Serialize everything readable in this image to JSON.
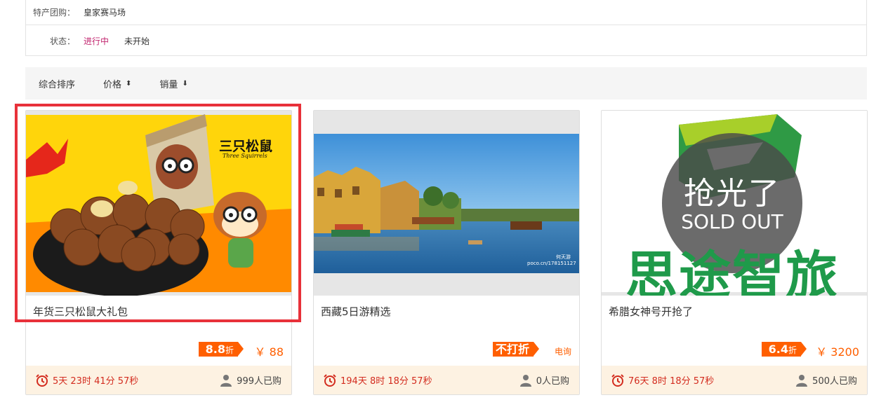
{
  "filters": {
    "tuangou": {
      "label": "特产团购：",
      "options": [
        "皇家赛马场"
      ]
    },
    "status": {
      "label": "状态：",
      "options": [
        "进行中",
        "未开始"
      ],
      "active": 0
    }
  },
  "sort": {
    "items": [
      {
        "label": "综合排序",
        "icon": ""
      },
      {
        "label": "价格",
        "icon": "⬍"
      },
      {
        "label": "销量",
        "icon": "⬇"
      }
    ]
  },
  "cards": [
    {
      "title": "年货三只松鼠大礼包",
      "discount": "8.8",
      "discount_unit": "折",
      "price": "￥ 88",
      "countdown": "5天 23时 41分 57秒",
      "buyers": "999人已购",
      "image": {
        "brand": "三只松鼠",
        "brand_sub": "Three Squirrels"
      }
    },
    {
      "title": "西藏5日游精选",
      "discount": "不打折",
      "discount_unit": "",
      "price": "电询",
      "countdown": "194天 8时 18分 57秒",
      "buyers": "0人已购",
      "image": {
        "watermark1": "何天游",
        "watermark2": "poco.cn/178151127"
      }
    },
    {
      "title": "希腊女神号开抢了",
      "discount": "6.4",
      "discount_unit": "折",
      "price": "￥ 3200",
      "countdown": "76天 8时 18分 57秒",
      "buyers": "500人已购",
      "image": {
        "brand": "思途智旅",
        "sold_cn": "抢光了",
        "sold_en": "SOLD OUT"
      }
    }
  ],
  "colors": {
    "accent": "#ff5f00",
    "countdown": "#d32c1f",
    "active_filter": "#c2266f",
    "highlight": "#e8313a"
  }
}
